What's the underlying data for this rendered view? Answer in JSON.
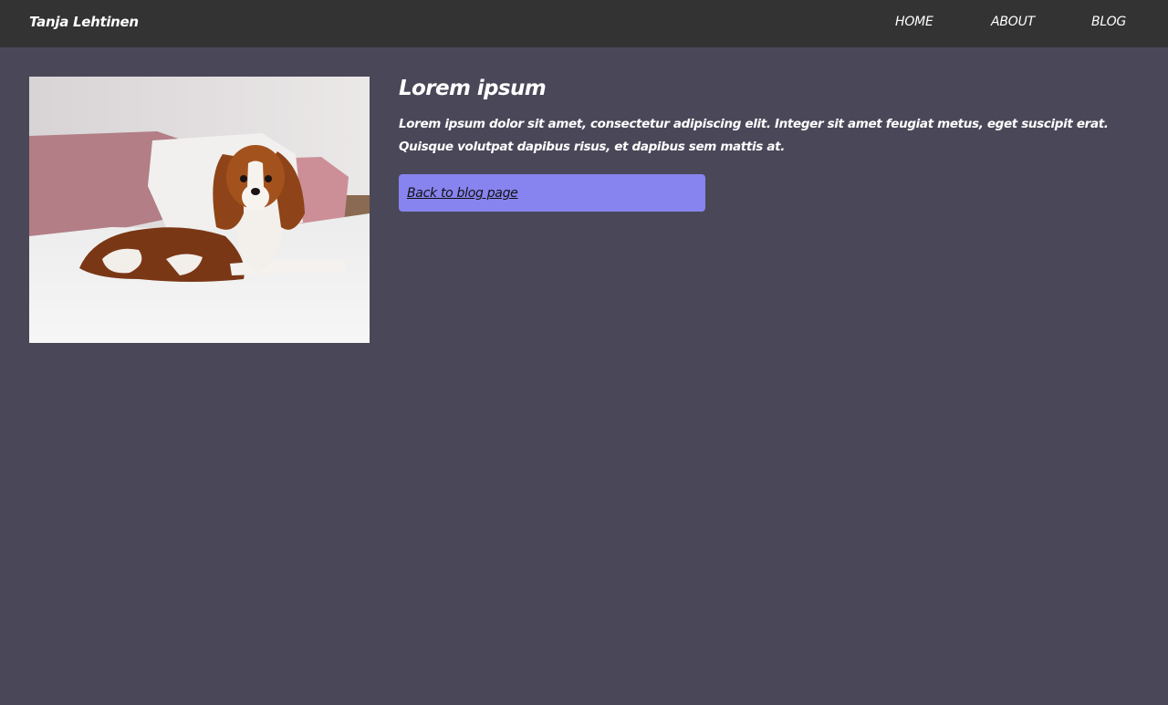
{
  "header": {
    "brand": "Tanja Lehtinen",
    "nav": [
      {
        "label": "HOME"
      },
      {
        "label": "ABOUT"
      },
      {
        "label": "BLOG"
      }
    ]
  },
  "post": {
    "title": "Lorem ipsum",
    "body": "Lorem ipsum dolor sit amet, consectetur adipiscing elit. Integer sit amet feugiat metus, eget suscipit erat. Quisque volutpat dapibus risus, et dapibus sem mattis at.",
    "back_link": "Back to blog page"
  },
  "colors": {
    "page_bg": "#4a4858",
    "header_bg": "#333333",
    "button_bg": "#8783ef"
  }
}
